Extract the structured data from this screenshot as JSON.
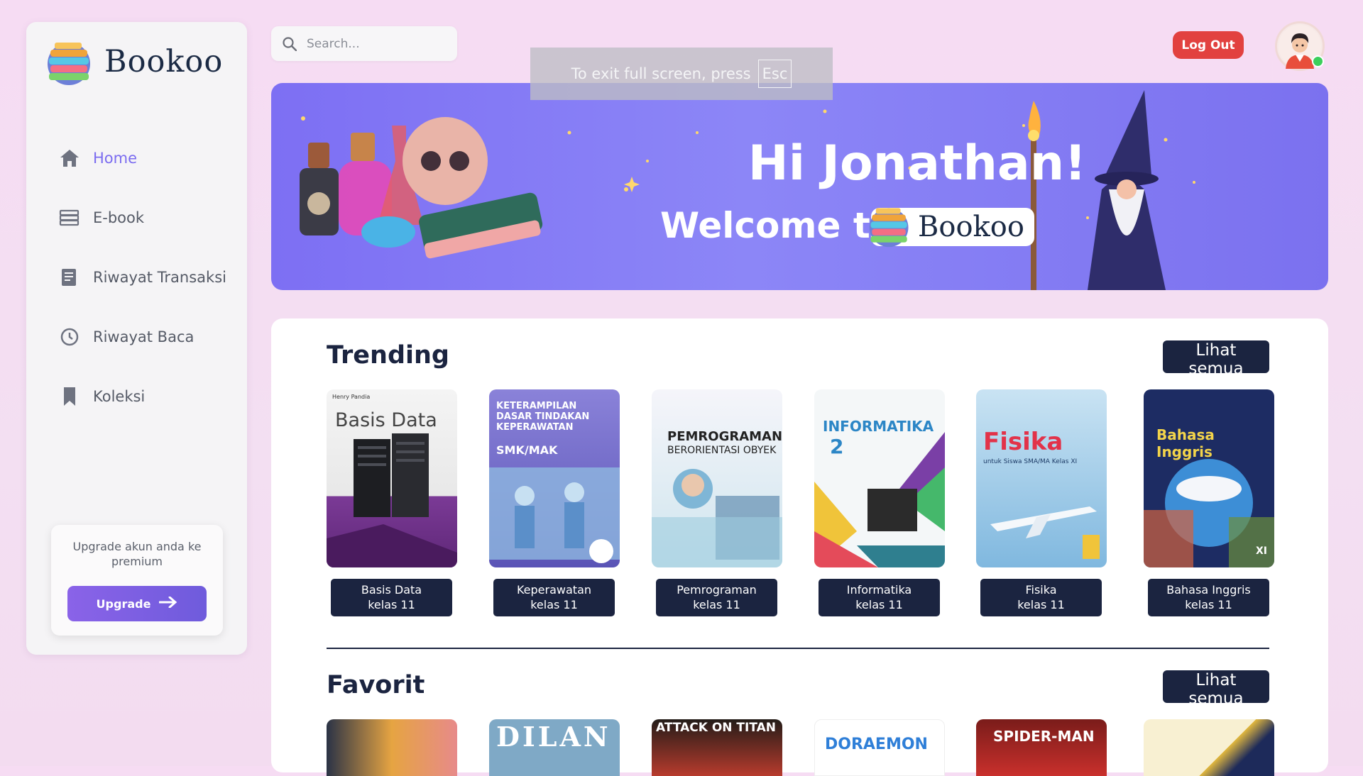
{
  "brand": {
    "name": "Bookoo"
  },
  "sidebar": {
    "items": [
      {
        "label": "Home",
        "icon": "home-icon",
        "active": true
      },
      {
        "label": "E-book",
        "icon": "books-icon",
        "active": false
      },
      {
        "label": "Riwayat Transaksi",
        "icon": "transaction-icon",
        "active": false
      },
      {
        "label": "Riwayat Baca",
        "icon": "history-icon",
        "active": false
      },
      {
        "label": "Koleksi",
        "icon": "bookmark-icon",
        "active": false
      }
    ],
    "upgrade": {
      "text": "Upgrade akun anda ke premium",
      "button": "Upgrade"
    }
  },
  "search": {
    "placeholder": "Search..."
  },
  "fullscreen_notice": {
    "text": "To exit full screen, press",
    "key": "Esc"
  },
  "header": {
    "logout": "Log Out"
  },
  "banner": {
    "greeting": "Hi Jonathan!",
    "welcome": "Welcome to",
    "brand": "Bookoo"
  },
  "trending": {
    "title": "Trending",
    "see_all": "Lihat semua",
    "books": [
      {
        "line1": "Basis Data",
        "line2": "kelas 11",
        "cover_title": "Basis Data",
        "cover_author": "Henry Pandia",
        "color": "#7b3a96"
      },
      {
        "line1": "Keperawatan",
        "line2": "kelas 11",
        "cover_title": "KETERAMPILAN DASAR TINDAKAN KEPERAWATAN",
        "cover_sub": "SMK/MAK",
        "color": "#6b63c4"
      },
      {
        "line1": "Pemrograman",
        "line2": "kelas 11",
        "cover_title": "PEMROGRAMAN",
        "cover_sub": "BERORIENTASI OBYEK",
        "color": "#d6e8f0"
      },
      {
        "line1": "Informatika",
        "line2": "kelas 11",
        "cover_title": "INFORMATIKA",
        "cover_sub": "2",
        "color": "#f2f6f7"
      },
      {
        "line1": "Fisika",
        "line2": "kelas 11",
        "cover_title": "Fisika",
        "cover_sub": "untuk Siswa SMA/MA Kelas XI",
        "color": "#8fc3e6"
      },
      {
        "line1": "Bahasa Inggris",
        "line2": "kelas 11",
        "cover_title": "Bahasa Inggris",
        "cover_sub": "XI",
        "color": "#1e2e66"
      }
    ]
  },
  "favorit": {
    "title": "Favorit",
    "see_all": "Lihat semua",
    "books": [
      {
        "cover_title": "",
        "color": "#e6a442"
      },
      {
        "cover_title": "DILAN",
        "color": "#7fa9c6"
      },
      {
        "cover_title": "ATTACK ON TITAN",
        "color": "#b83b2d"
      },
      {
        "cover_title": "DORAEMON",
        "color": "#ffffff"
      },
      {
        "cover_title": "SPIDER-MAN",
        "color": "#c9302c"
      },
      {
        "cover_title": "",
        "color": "#f8f0d2"
      }
    ]
  }
}
